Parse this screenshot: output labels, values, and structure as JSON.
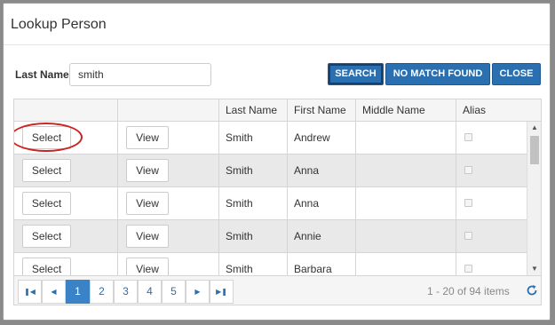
{
  "dialog": {
    "title": "Lookup Person"
  },
  "search": {
    "last_name_label": "Last Name",
    "last_name_value": "smith",
    "search_label": "SEARCH",
    "no_match_label": "NO MATCH FOUND",
    "close_label": "CLOSE"
  },
  "grid": {
    "columns": [
      "",
      "",
      "Last Name",
      "First Name",
      "Middle Name",
      "Alias"
    ],
    "select_label": "Select",
    "view_label": "View",
    "rows": [
      {
        "last": "Smith",
        "first": "Andrew",
        "middle": "",
        "alias": false
      },
      {
        "last": "Smith",
        "first": "Anna",
        "middle": "",
        "alias": false
      },
      {
        "last": "Smith",
        "first": "Anna",
        "middle": "",
        "alias": false
      },
      {
        "last": "Smith",
        "first": "Annie",
        "middle": "",
        "alias": false
      },
      {
        "last": "Smith",
        "first": "Barbara",
        "middle": "",
        "alias": false
      }
    ]
  },
  "pager": {
    "pages": [
      "1",
      "2",
      "3",
      "4",
      "5"
    ],
    "current_page": "1",
    "info": "1 - 20 of 94 items"
  },
  "colors": {
    "primary_button": "#2a6fb0",
    "active_page": "#3b83c7",
    "annotation_circle": "#cc2222"
  }
}
